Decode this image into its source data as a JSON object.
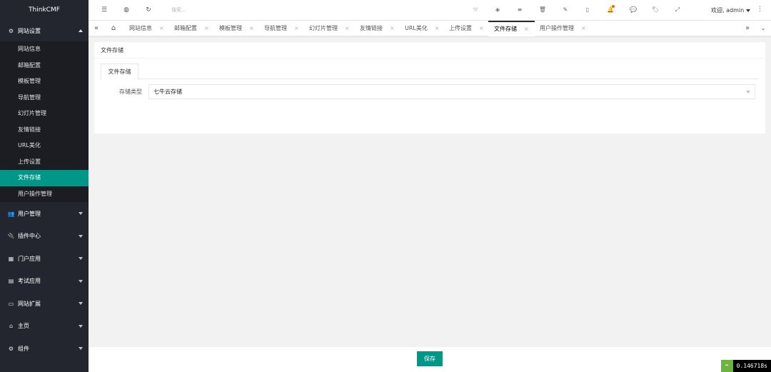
{
  "brand": "ThinkCMF",
  "sidebar": {
    "open_group": {
      "label": "网站设置",
      "icon": "gears-icon"
    },
    "sub_items": [
      {
        "label": "网站信息"
      },
      {
        "label": "邮箱配置"
      },
      {
        "label": "模板管理"
      },
      {
        "label": "导航管理"
      },
      {
        "label": "幻灯片管理"
      },
      {
        "label": "友情链接"
      },
      {
        "label": "URL美化"
      },
      {
        "label": "上传设置"
      },
      {
        "label": "文件存储"
      },
      {
        "label": "用户操作管理"
      }
    ],
    "groups": [
      {
        "label": "用户管理",
        "glyph": "👥"
      },
      {
        "label": "插件中心",
        "glyph": "🔌"
      },
      {
        "label": "门户应用",
        "glyph": "▦"
      },
      {
        "label": "考试应用",
        "glyph": "▤"
      },
      {
        "label": "网站扩展",
        "glyph": "▭"
      },
      {
        "label": "主页",
        "glyph": "⌂"
      },
      {
        "label": "组件",
        "glyph": "⚙"
      }
    ]
  },
  "topbar": {
    "search_placeholder": "搜索...",
    "welcome": "欢迎, admin"
  },
  "tabs": [
    {
      "label": "网站信息"
    },
    {
      "label": "邮箱配置"
    },
    {
      "label": "模板管理"
    },
    {
      "label": "导航管理"
    },
    {
      "label": "幻灯片管理"
    },
    {
      "label": "友情链接"
    },
    {
      "label": "URL美化"
    },
    {
      "label": "上传设置"
    },
    {
      "label": "文件存储"
    },
    {
      "label": "用户操作管理"
    }
  ],
  "main": {
    "card_title": "文件存储",
    "inner_tab": "文件存储",
    "field_label": "存储类型",
    "field_value": "七牛云存储"
  },
  "footer": {
    "save_label": "保存"
  },
  "debug_time": "0.146718s",
  "colors": {
    "accent": "#009688",
    "sidebar_bg": "#23262e"
  }
}
